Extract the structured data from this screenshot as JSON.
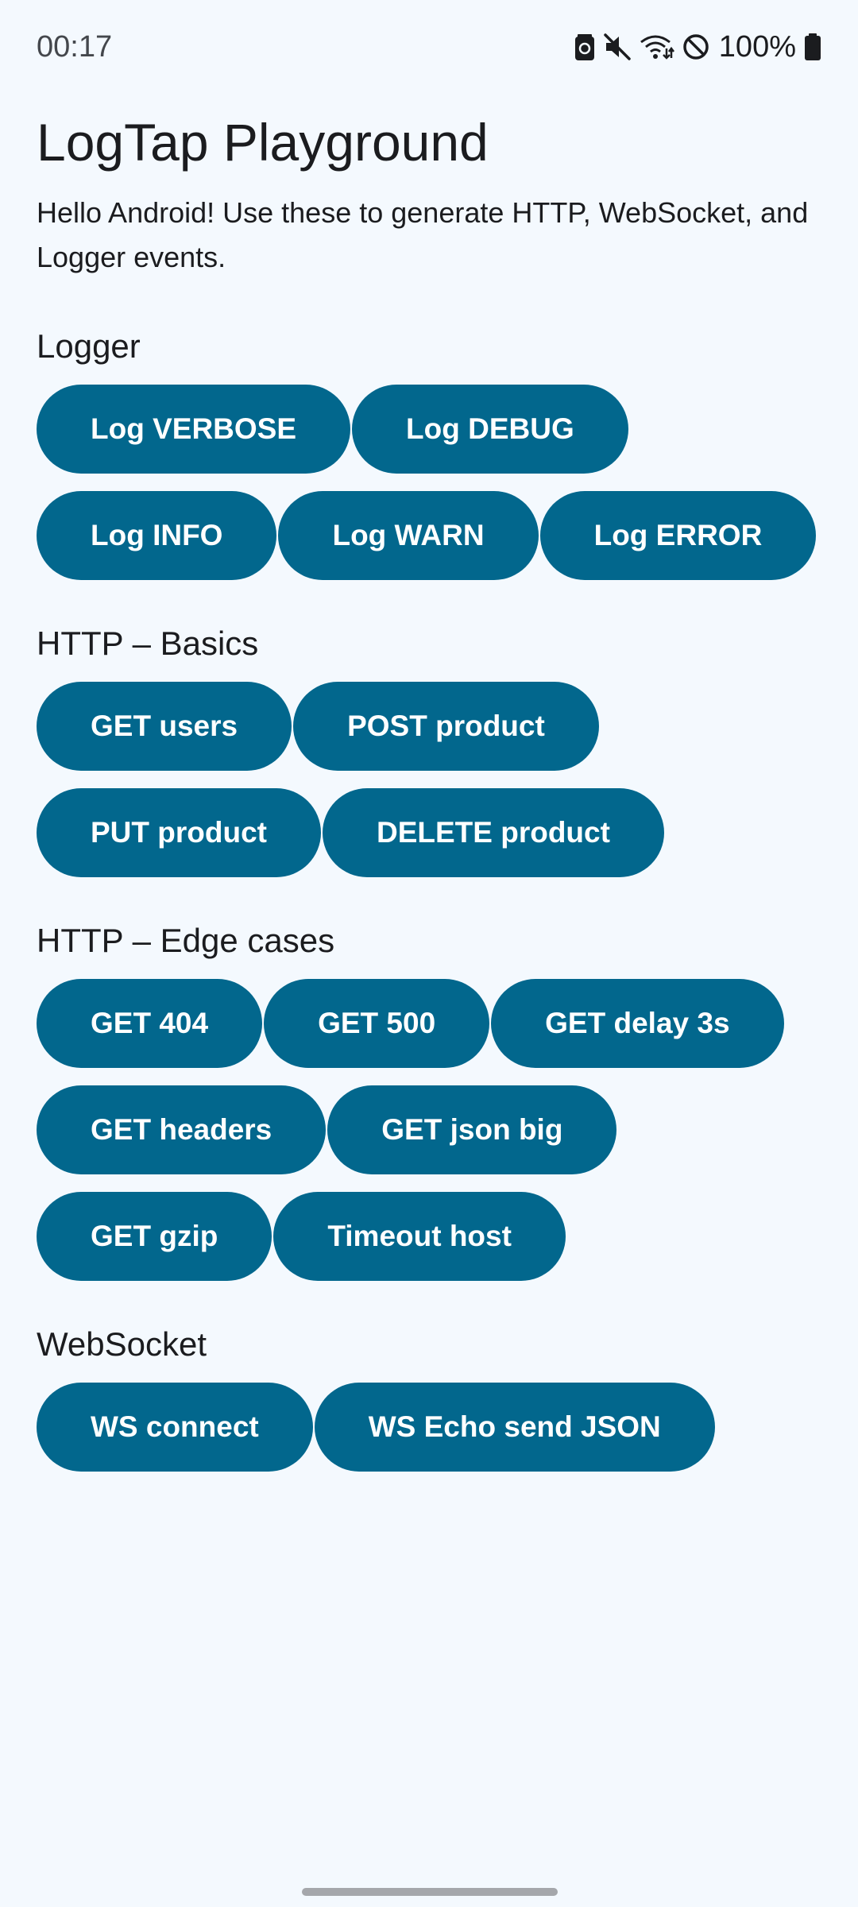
{
  "status_bar": {
    "time": "00:17",
    "battery_percent": "100%",
    "icons": [
      "battery-saver-icon",
      "mute-icon",
      "wifi-icon",
      "do-not-disturb-icon",
      "battery-icon"
    ]
  },
  "header": {
    "title": "LogTap Playground",
    "subtitle": "Hello Android! Use these to generate HTTP, WebSocket, and Logger events."
  },
  "sections": {
    "logger": {
      "title": "Logger",
      "buttons": [
        "Log VERBOSE",
        "Log DEBUG",
        "Log INFO",
        "Log WARN",
        "Log ERROR"
      ]
    },
    "http_basics": {
      "title": "HTTP – Basics",
      "buttons": [
        "GET users",
        "POST product",
        "PUT product",
        "DELETE product"
      ]
    },
    "http_edge": {
      "title": "HTTP – Edge cases",
      "buttons": [
        "GET 404",
        "GET 500",
        "GET delay 3s",
        "GET headers",
        "GET json big",
        "GET gzip",
        "Timeout host"
      ]
    },
    "websocket": {
      "title": "WebSocket",
      "buttons": [
        "WS connect",
        "WS Echo send JSON"
      ]
    }
  },
  "colors": {
    "background": "#f4f9fe",
    "button": "#02678d",
    "button_text": "#ffffff",
    "text": "#1b1c1f"
  }
}
